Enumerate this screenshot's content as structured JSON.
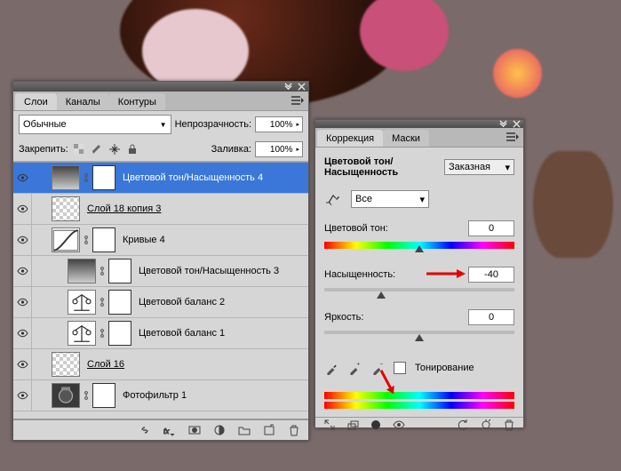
{
  "layers_panel": {
    "tabs": [
      "Слои",
      "Каналы",
      "Контуры"
    ],
    "active_tab": 0,
    "blend_mode": "Обычные",
    "opacity_label": "Непрозрачность:",
    "opacity_value": "100%",
    "lock_label": "Закрепить:",
    "fill_label": "Заливка:",
    "fill_value": "100%",
    "layers": [
      {
        "name": "Цветовой тон/Насыщенность 4",
        "kind": "hue",
        "indent": 1,
        "selected": true
      },
      {
        "name": "Слой 18 копия 3",
        "kind": "image",
        "indent": 1,
        "underline": true
      },
      {
        "name": "Кривые 4",
        "kind": "curves",
        "indent": 1
      },
      {
        "name": "Цветовой тон/Насыщенность 3",
        "kind": "hue",
        "indent": 2
      },
      {
        "name": "Цветовой баланс 2",
        "kind": "balance",
        "indent": 2
      },
      {
        "name": "Цветовой баланс 1",
        "kind": "balance",
        "indent": 2
      },
      {
        "name": "Слой 16",
        "kind": "image",
        "indent": 1,
        "underline": true
      },
      {
        "name": "Фотофильтр 1",
        "kind": "photofilt",
        "indent": 1
      }
    ]
  },
  "correction_panel": {
    "tabs": [
      "Коррекция",
      "Маски"
    ],
    "active_tab": 0,
    "title": "Цветовой тон/Насыщенность",
    "preset": "Заказная",
    "channel": "Все",
    "hue_label": "Цветовой тон:",
    "hue_value": "0",
    "sat_label": "Насыщенность:",
    "sat_value": "-40",
    "lig_label": "Яркость:",
    "lig_value": "0",
    "colorize_label": "Тонирование"
  }
}
